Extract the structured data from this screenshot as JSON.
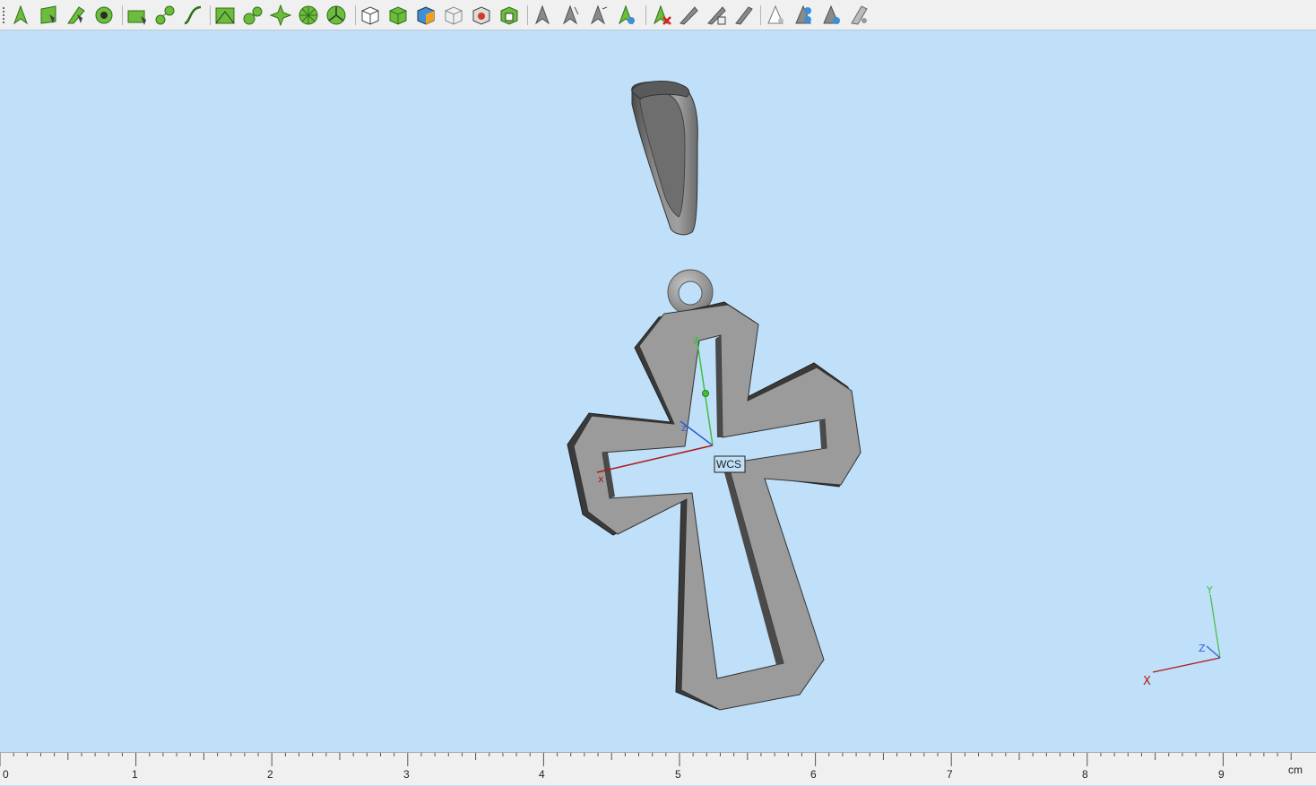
{
  "toolbar": {
    "groups": [
      [
        "select-points-tool",
        "select-faces-tool",
        "select-edges-tool",
        "select-loops-tool"
      ],
      [
        "sketch-rectangle-tool",
        "sketch-circle-tool",
        "sketch-curve-tool"
      ],
      [
        "mesh-tool",
        "node-tool",
        "pattern-tool",
        "rotate-pattern-tool",
        "radial-tool"
      ],
      [
        "box-view-tool",
        "shaded-box-tool",
        "colored-box-tool",
        "wire-box-tool",
        "render-box-tool",
        "texture-box-tool"
      ],
      [
        "arrow-tool",
        "arrow-split-tool",
        "arrow-merge-tool",
        "arrow-color-tool"
      ],
      [
        "delete-tool",
        "layer-tool",
        "layer-edit-tool",
        "layer-shade-tool"
      ],
      [
        "light-tool",
        "light-color-tool",
        "light-eye-tool",
        "light-off-tool"
      ]
    ]
  },
  "viewport": {
    "background": "#bfe0f8",
    "wcs_label": "WCS",
    "local_axes": {
      "x": "x",
      "z": "z",
      "y": "y"
    },
    "corner_axes": {
      "x": "X",
      "y": "Y",
      "z": "Z"
    },
    "colors": {
      "x_axis": "#b01818",
      "y_axis": "#3fbf3f",
      "z_axis": "#2a5fd8",
      "metal": "#9b9b9b",
      "metal_dark": "#3a3a3a"
    }
  },
  "ruler": {
    "labels": [
      "0",
      "1",
      "2",
      "3",
      "4",
      "5",
      "6",
      "7",
      "8",
      "9"
    ],
    "unit": "cm"
  }
}
